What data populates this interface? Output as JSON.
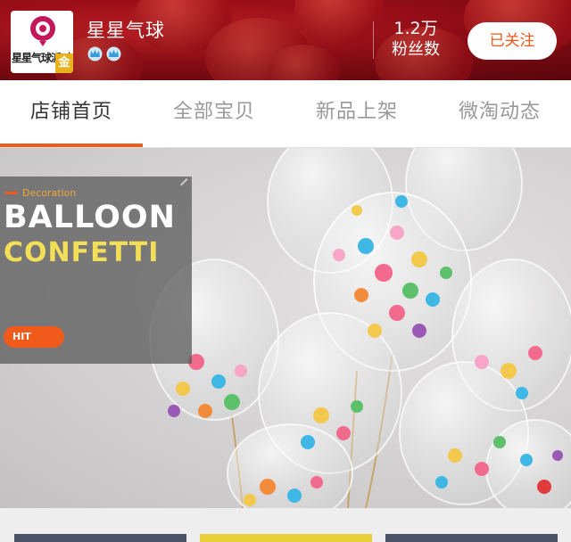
{
  "shop": {
    "logo_text": "星星气球派对",
    "logo_badge": "金",
    "name": "星星气球",
    "fans_count": "1.2万",
    "fans_label": "粉丝数",
    "follow_label": "已关注",
    "crown_icons": [
      "crown-icon",
      "crown-icon"
    ]
  },
  "tabs": [
    {
      "label": "店铺首页",
      "active": true
    },
    {
      "label": "全部宝贝",
      "active": false
    },
    {
      "label": "新品上架",
      "active": false
    },
    {
      "label": "微淘动态",
      "active": false
    }
  ],
  "banner": {
    "tag": "Decoration",
    "line1": "BALLOON",
    "line2": "CONFETTI",
    "pill": "HIT"
  },
  "colors": {
    "accent": "#f05a1a",
    "header_red": "#c01420",
    "promo_yellow": "#f3df57",
    "thumb_colors": [
      "#4a5368",
      "#e9cf3a",
      "#4a5368"
    ]
  }
}
